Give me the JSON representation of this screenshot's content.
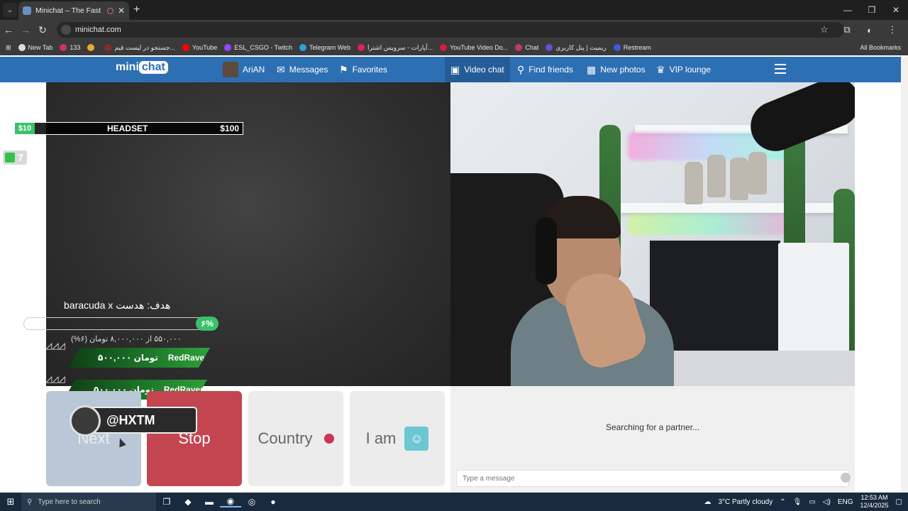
{
  "browser": {
    "tab_title": "Minichat – The Fast Video C",
    "tab_close": "✕",
    "new_tab": "+",
    "tab_list": "⌄",
    "window": {
      "minimize": "—",
      "restore": "❐",
      "close": "✕"
    },
    "nav": {
      "back": "←",
      "forward": "→",
      "reload": "↻"
    },
    "url": "minichat.com",
    "star": "☆",
    "extensions": "⧉",
    "menu": "⋮",
    "apps": "⊞",
    "bookmarks": [
      {
        "label": "New Tab",
        "color": "#dddddd"
      },
      {
        "label": "133",
        "color": "#d0306a"
      },
      {
        "label": "",
        "color": "#e7a93a"
      },
      {
        "label": "جستجو در لیست قیم...",
        "color": "#8a2b2b"
      },
      {
        "label": "YouTube",
        "color": "#ff0000"
      },
      {
        "label": "ESL_CSGO - Twitch",
        "color": "#9146ff"
      },
      {
        "label": "Telegram Web",
        "color": "#2aa3de"
      },
      {
        "label": "آپارات - سرویس اشترا...",
        "color": "#e01f5d"
      },
      {
        "label": "YouTube Video Do...",
        "color": "#d01f3a"
      },
      {
        "label": "Chat",
        "color": "#c03a6a"
      },
      {
        "label": "ریمیت | پنل کاربری",
        "color": "#6a4bd6"
      },
      {
        "label": "Restream",
        "color": "#3b5bdb"
      }
    ],
    "all_bookmarks": "All Bookmarks"
  },
  "site": {
    "logo_left": "mini",
    "logo_right": "chat",
    "user_name": "AriAN",
    "messages": "Messages",
    "favorites": "Favorites",
    "video_chat": "Video chat",
    "find_friends": "Find friends",
    "new_photos": "New photos",
    "vip_lounge": "VIP lounge"
  },
  "overlay": {
    "goal_low": "$10",
    "goal_name": "HEADSET",
    "goal_high": "$100",
    "viewer_count": "7",
    "goal_title": "هدف: هدست baracuda x",
    "goal_percent": "۶%",
    "goal_progress_value": 0.06,
    "goal_progress_text": "۵۵۰,۰۰۰ از ۸,۰۰۰,۰۰۰ تومان (۶%)",
    "donations": [
      {
        "amount": "۵۰۰,۰۰۰ تومان",
        "name": "RedRaven"
      },
      {
        "amount": "۵۰۰,۰۰۰ تومان",
        "name": "RedRaven"
      }
    ],
    "watermark": "@HXTM"
  },
  "controls": {
    "next": "Next",
    "stop": "Stop",
    "country": "Country",
    "iam": "I am"
  },
  "chat": {
    "status": "Searching for a partner...",
    "placeholder": "Type a message"
  },
  "taskbar": {
    "start": "⊞",
    "search_placeholder": "Type here to search",
    "weather": "3°C  Partly cloudy",
    "lang": "ENG",
    "time": "12:53 AM",
    "date": "12/4/2025"
  }
}
